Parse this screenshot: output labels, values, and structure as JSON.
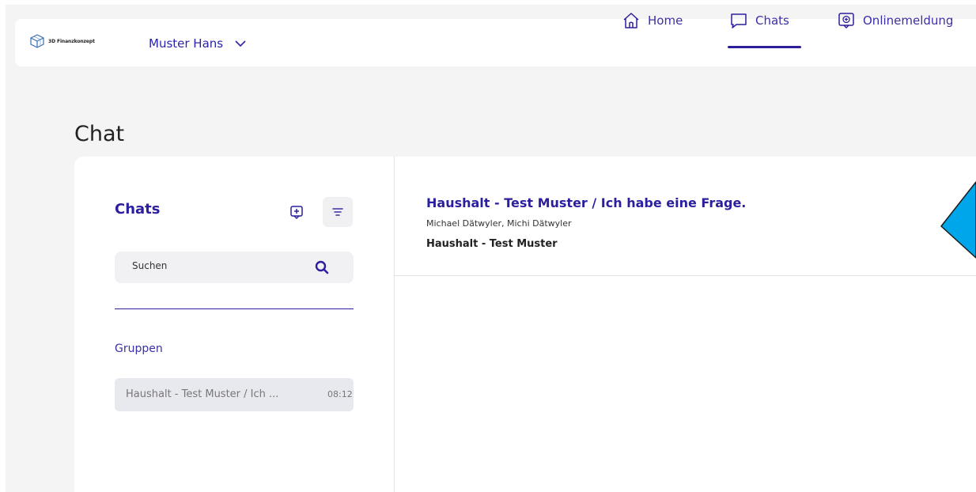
{
  "brand": {
    "name": "3D Finanzkonzept",
    "logo_icon": "cube-logo-icon"
  },
  "user": {
    "name": "Muster Hans"
  },
  "nav": {
    "items": [
      {
        "label": "Home",
        "icon": "home-icon"
      },
      {
        "label": "Chats",
        "icon": "chat-bubble-icon",
        "active": true
      },
      {
        "label": "Onlinemeldung",
        "icon": "add-document-icon"
      }
    ],
    "accent_color": "#2b1f9e"
  },
  "page": {
    "title": "Chat"
  },
  "sidebar": {
    "title": "Chats",
    "search": {
      "placeholder": "Suchen"
    },
    "section_label": "Gruppen",
    "groups": [
      {
        "name": "Haushalt - Test Muster / Ich ...",
        "time": "08:12"
      }
    ]
  },
  "conversation": {
    "title": "Haushalt - Test Muster / Ich habe eine Frage.",
    "participants": "Michael Dätwyler, Michi Dätwyler",
    "group": "Haushalt - Test Muster"
  }
}
